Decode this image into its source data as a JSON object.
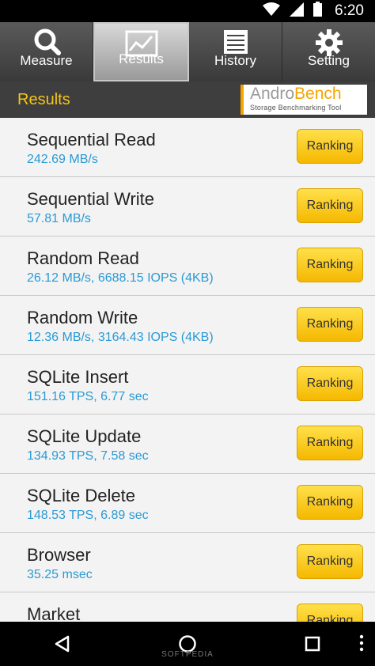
{
  "status_bar": {
    "time": "6:20"
  },
  "tabs": [
    {
      "label": "Measure",
      "icon": "magnifier-icon"
    },
    {
      "label": "Results",
      "icon": "chart-icon",
      "active": true
    },
    {
      "label": "History",
      "icon": "list-icon"
    },
    {
      "label": "Setting",
      "icon": "gear-icon"
    }
  ],
  "header": {
    "title": "Results",
    "logo_andro": "Andro",
    "logo_bench": "Bench",
    "logo_sub": "Storage Benchmarking Tool"
  },
  "results": [
    {
      "name": "Sequential Read",
      "value": "242.69 MB/s",
      "button": "Ranking"
    },
    {
      "name": "Sequential Write",
      "value": "57.81 MB/s",
      "button": "Ranking"
    },
    {
      "name": "Random Read",
      "value": "26.12 MB/s, 6688.15 IOPS (4KB)",
      "button": "Ranking"
    },
    {
      "name": "Random Write",
      "value": "12.36 MB/s, 3164.43 IOPS (4KB)",
      "button": "Ranking"
    },
    {
      "name": "SQLite Insert",
      "value": "151.16 TPS, 6.77 sec",
      "button": "Ranking"
    },
    {
      "name": "SQLite Update",
      "value": "134.93 TPS, 7.58 sec",
      "button": "Ranking"
    },
    {
      "name": "SQLite Delete",
      "value": "148.53 TPS, 6.89 sec",
      "button": "Ranking"
    },
    {
      "name": "Browser",
      "value": "35.25 msec",
      "button": "Ranking"
    },
    {
      "name": "Market",
      "value": "",
      "button": "Ranking"
    }
  ],
  "watermark": "SOFTPEDIA",
  "colors": {
    "accent": "#f5c518",
    "value_text": "#2a9ad6",
    "button": "#ffd21a"
  }
}
